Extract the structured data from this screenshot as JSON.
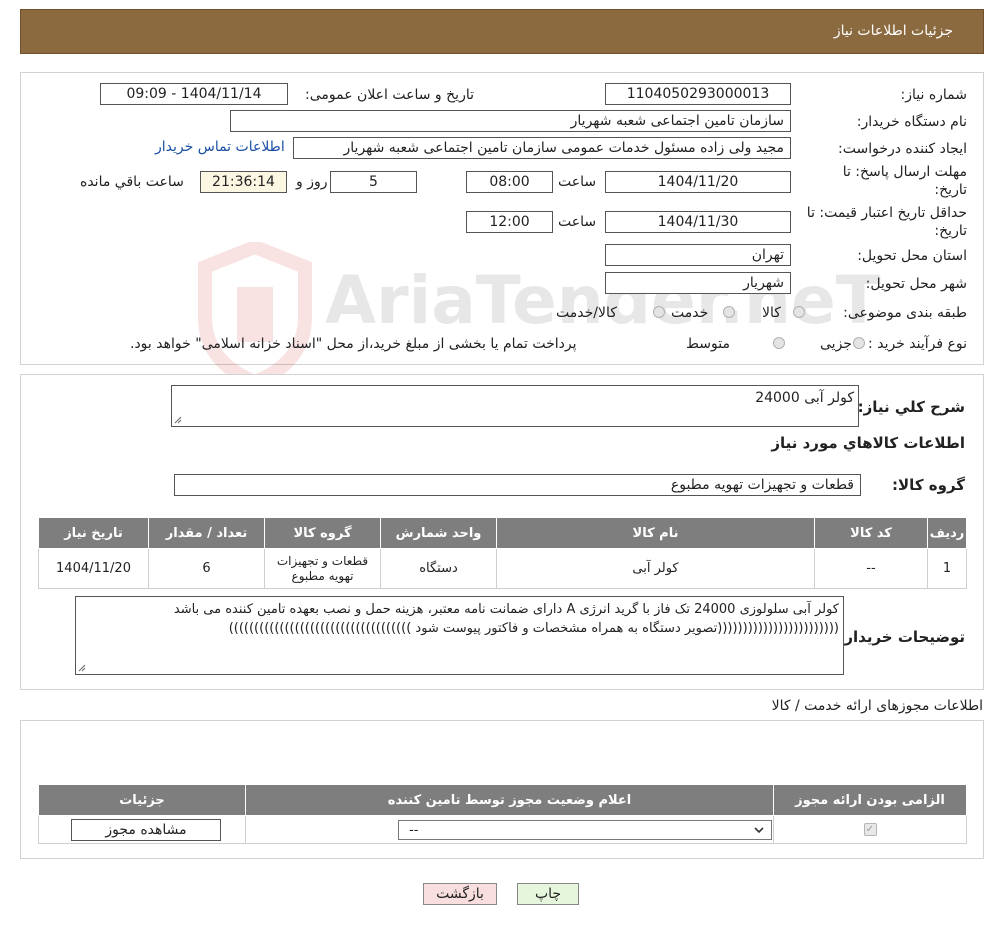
{
  "header": {
    "title": "جزئیات اطلاعات نیاز"
  },
  "fields": {
    "need_number_label": "شماره نیاز:",
    "need_number": "1104050293000013",
    "announce_label": "تاریخ و ساعت اعلان عمومی:",
    "announce_value": "1404/11/14 - 09:09",
    "buyer_org_label": "نام دستگاه خریدار:",
    "buyer_org": "سازمان تامین اجتماعی شعبه شهریار",
    "requester_label": "ایجاد کننده درخواست:",
    "requester": "مجید ولی زاده مسئول خدمات عمومی سازمان تامین اجتماعی شعبه شهریار",
    "contact_link": "اطلاعات تماس خریدار",
    "reply_deadline_label_1": "مهلت ارسال پاسخ: تا",
    "reply_deadline_label_2": "تاریخ:",
    "reply_date": "1404/11/20",
    "hour_label": "ساعت",
    "reply_time": "08:00",
    "days_value": "5",
    "day_and_label": "روز و",
    "remaining_time": "21:36:14",
    "remaining_label": "ساعت باقي مانده",
    "validity_label_1": "حداقل تاریخ اعتبار قیمت: تا",
    "validity_label_2": "تاریخ:",
    "validity_date": "1404/11/30",
    "validity_time": "12:00",
    "province_label": "استان محل تحویل:",
    "province": "تهران",
    "city_label": "شهر محل تحویل:",
    "city": "شهریار",
    "category_label": "طبقه بندی موضوعی:",
    "category_options": [
      "کالا",
      "خدمت",
      "کالا/خدمت"
    ],
    "process_label": "نوع فرآیند خرید :",
    "process_options": [
      "جزیی",
      "متوسط"
    ],
    "process_note": "پرداخت تمام یا بخشی از مبلغ خرید،از محل \"اسناد خزانه اسلامی\" خواهد بود."
  },
  "summary": {
    "label": "شرح کلي نياز:",
    "value": "کولر آبی 24000",
    "goods_info_title": "اطلاعات کالاهاي مورد نياز",
    "goods_group_label": "گروه کالا:",
    "goods_group": "قطعات و تجهیزات تهویه مطبوع"
  },
  "goods_table": {
    "headers": [
      "ردیف",
      "کد کالا",
      "نام کالا",
      "واحد شمارش",
      "گروه کالا",
      "تعداد / مقدار",
      "تاریخ نیاز"
    ],
    "rows": [
      {
        "row": "1",
        "code": "--",
        "name": "کولر آبی",
        "unit": "دستگاه",
        "group": "قطعات و تجهیزات تهویه مطبوع",
        "qty": "6",
        "date": "1404/11/20"
      }
    ]
  },
  "buyer_notes": {
    "label": "توضیحات خریدار:",
    "line1": "کولر آبی سلولوزی 24000 تک فاز با گرید انرژی A دارای ضمانت نامه معتبر، هزینه حمل و نصب بعهده تامین کننده می باشد",
    "line2": "((((((((((((((((((((((((تصویر دستگاه به همراه مشخصات و فاکتور پیوست شود ))))))))))))))))))))))))))))))))))))"
  },
  "permits": {
    "title": "اطلاعات مجوزهای ارائه خدمت / کالا",
    "headers": [
      "الزامی بودن ارائه مجوز",
      "اعلام وضعیت مجوز توسط تامین کننده",
      "جزئیات"
    ],
    "select_value": "--",
    "view_button": "مشاهده مجوز"
  },
  "buttons": {
    "back": "بازگشت",
    "print": "چاپ"
  },
  "watermark": {
    "text": "AriaTender.neT"
  },
  "colors": {
    "header_bg": "#8b6a3f",
    "table_header_bg": "#7e7e7e",
    "link": "#1b4fa6",
    "back_btn": "#f8dede",
    "print_btn": "#e6f6dc",
    "timer_bg": "#fbf7e2"
  }
}
